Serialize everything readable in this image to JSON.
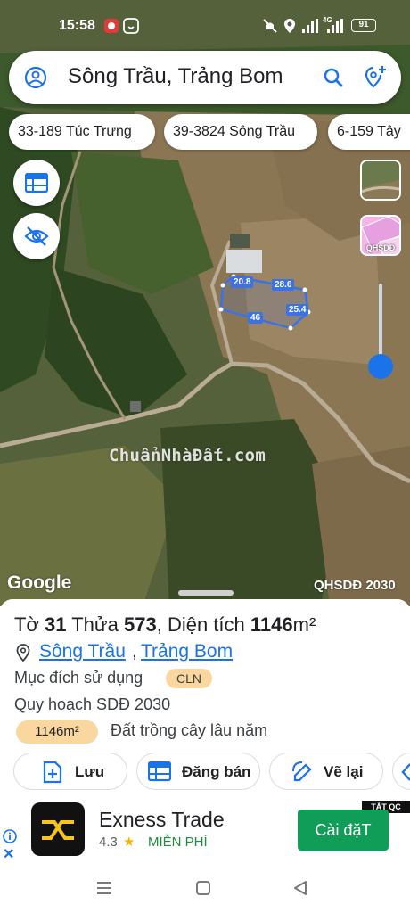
{
  "status_bar": {
    "time": "15:58",
    "network": "4G",
    "battery": "91",
    "icons": [
      "app-notification-icon",
      "smile-icon",
      "mute-icon",
      "location-icon",
      "signal-icon",
      "signal-icon-2",
      "battery-icon"
    ]
  },
  "search": {
    "text": "Sông Trầu, Trảng Bom",
    "icons": [
      "account-icon",
      "search-icon",
      "add-location-icon"
    ]
  },
  "chips": [
    "33-189 Túc Trưng",
    "39-3824 Sông Trầu",
    "6-159 Tây"
  ],
  "map": {
    "left_buttons": [
      "layers-table-icon",
      "visibility-off-icon"
    ],
    "right_layers": {
      "satellite_thumb": "satellite-layer-icon",
      "planning_label": "QHSDĐ"
    },
    "dimensions": [
      "20.8",
      "28.6",
      "25.4",
      "46"
    ],
    "watermark": "ChuẩnNhàĐất.com",
    "google_logo": "Google",
    "caption": "QHSDĐ 2030",
    "parcel_outline_color": "#3b73e6"
  },
  "parcel": {
    "sheet_label": "Tờ",
    "sheet_no": "31",
    "plot_label": "Thửa",
    "plot_no": "573",
    "area_label": "Diện tích",
    "area_value": "1146",
    "area_unit": "m²",
    "commune": "Sông Trầu",
    "district": "Trảng Bom",
    "purpose_label": "Mục đích sử dụng",
    "purpose_code": "CLN",
    "plan_label": "Quy hoạch SDĐ 2030",
    "plan_area": "1146m²",
    "plan_desc": "Đất trồng cây lâu năm",
    "badge_color": "#f9d79e"
  },
  "actions": [
    {
      "label": "Lưu",
      "icon": "add-bookmark-icon"
    },
    {
      "label": "Đăng bán",
      "icon": "listing-icon"
    },
    {
      "label": "Vẽ lại",
      "icon": "redraw-icon"
    }
  ],
  "ad": {
    "title": "Exness Trade",
    "rating": "4.3",
    "free": "MIỄN PHÍ",
    "cta": "Cài đặT",
    "tag": "TẮT QC",
    "cta_color": "#0f9d58"
  },
  "nav": [
    "menu-icon",
    "home-icon",
    "back-icon"
  ]
}
